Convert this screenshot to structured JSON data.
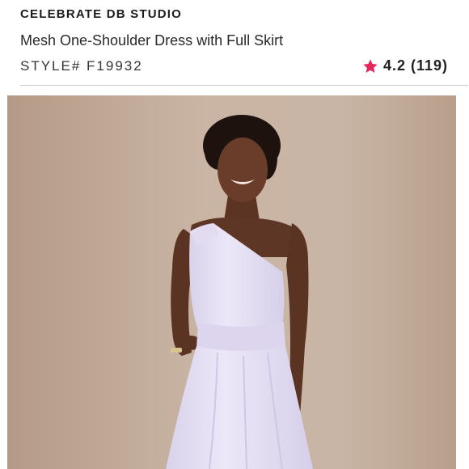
{
  "product": {
    "brand": "CELEBRATE DB STUDIO",
    "name": "Mesh One-Shoulder Dress with Full Skirt",
    "style_label": "STYLE#",
    "style_number": "F19932",
    "rating": {
      "value": "4.2",
      "count": "(119)",
      "icon": "star-icon",
      "color": "#e8255a"
    }
  },
  "image": {
    "alt": "Model wearing lilac mesh one-shoulder dress with full skirt",
    "background_color": "#c7b2a2",
    "dress_color": "#e6e0f3"
  }
}
